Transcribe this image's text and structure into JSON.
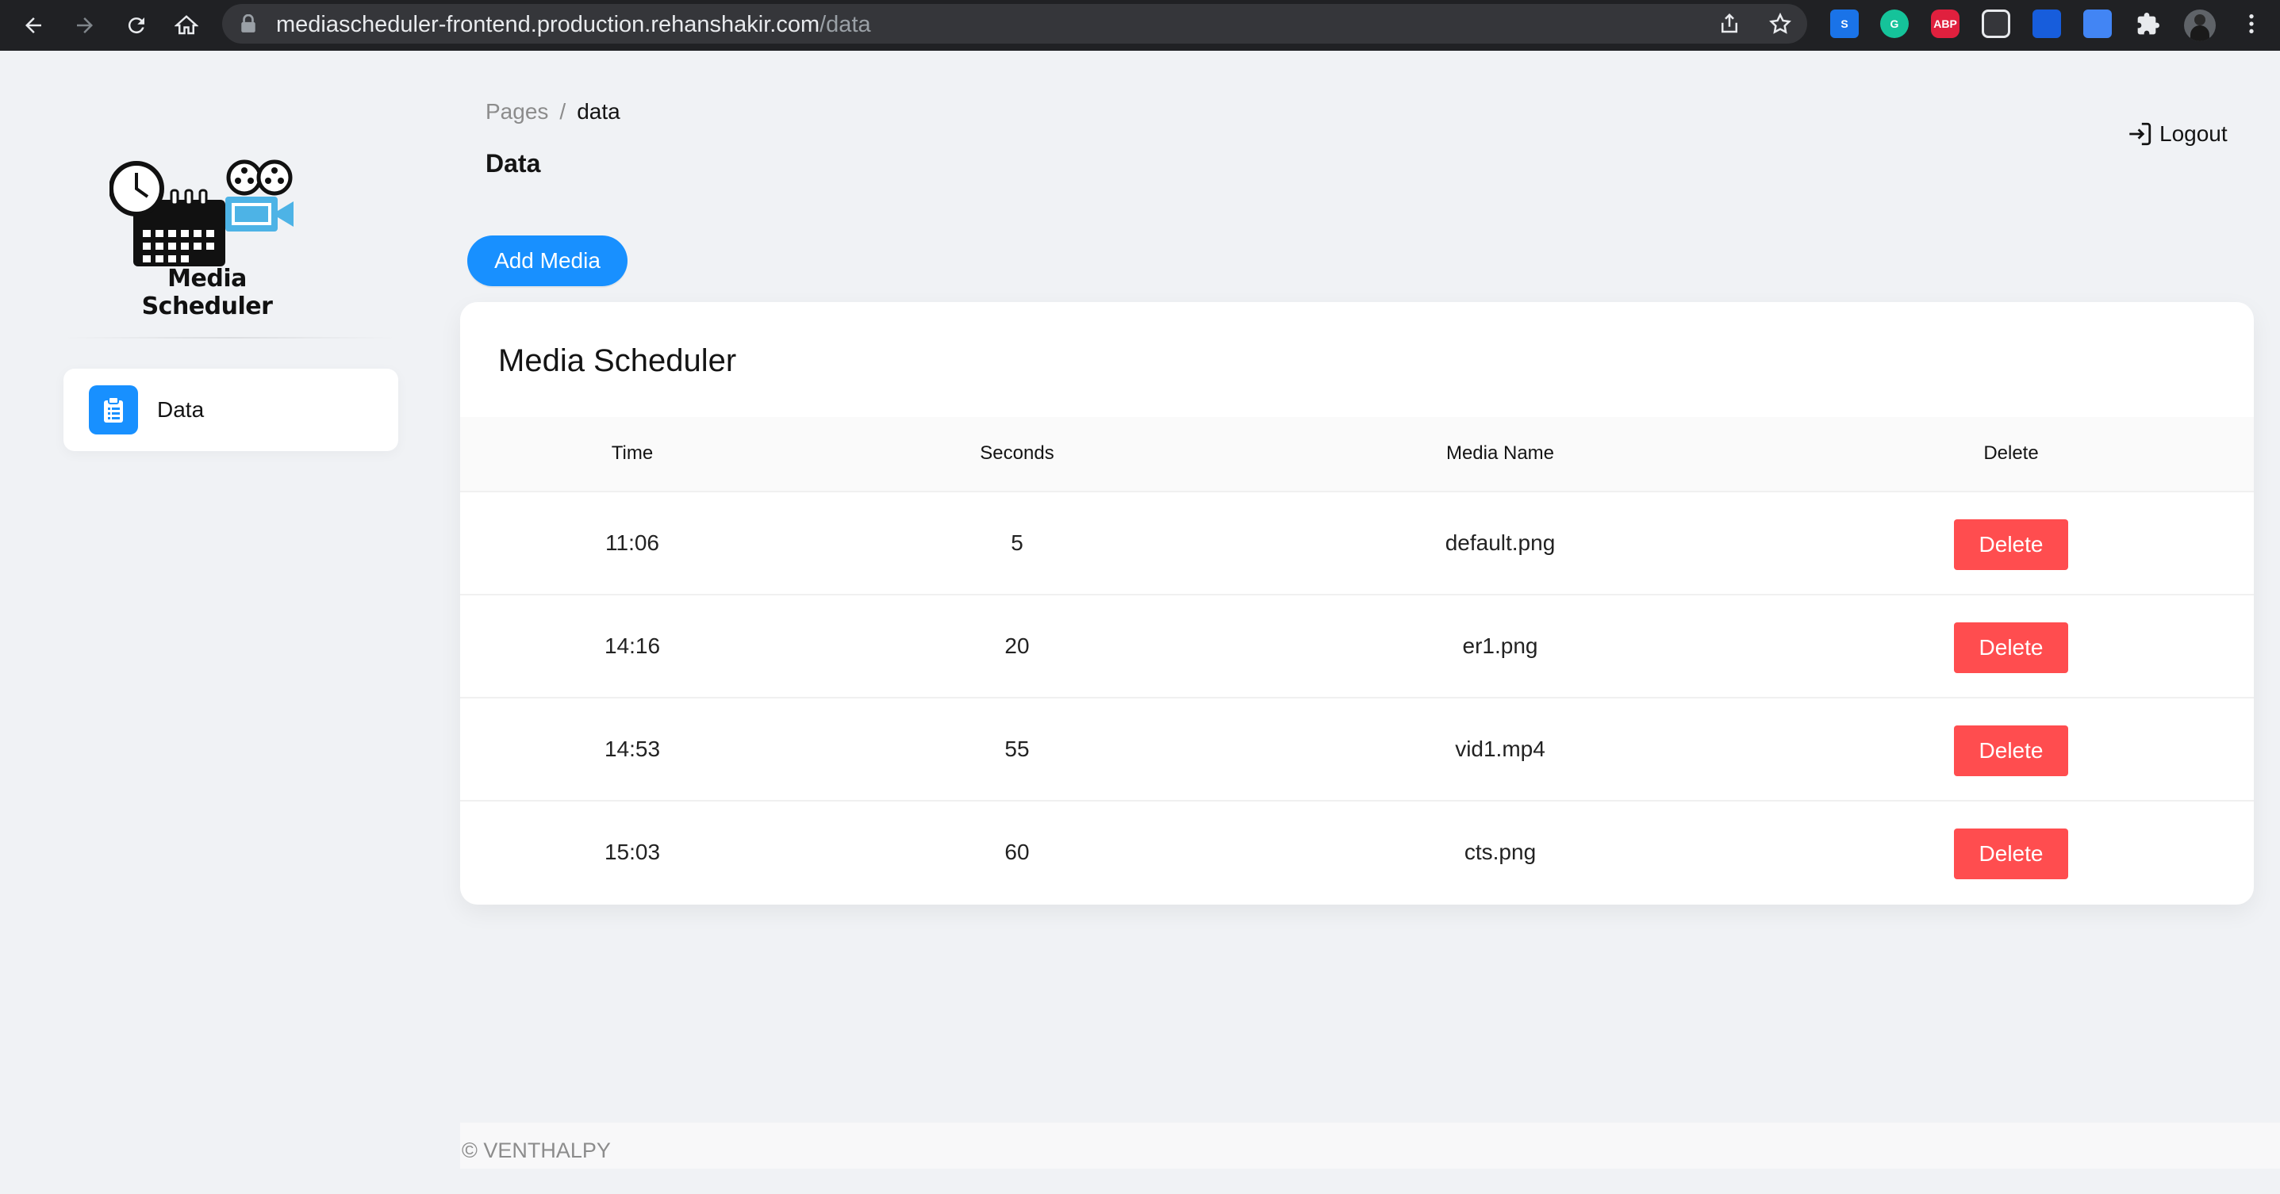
{
  "browser": {
    "url_host": "mediascheduler-frontend.production.rehanshakir.com",
    "url_path": "/data",
    "extensions": [
      {
        "name": "s-extension-icon",
        "label": "S",
        "color": "#1a73e8"
      },
      {
        "name": "grammarly-icon",
        "label": "G",
        "color": "#15c39a"
      },
      {
        "name": "adblock-plus-icon",
        "label": "ABP",
        "color": "#e0203e"
      },
      {
        "name": "pocket-icon",
        "label": "",
        "color": "#35363a"
      },
      {
        "name": "bitwarden-icon",
        "label": "",
        "color": "#175ddc"
      },
      {
        "name": "google-translate-icon",
        "label": "",
        "color": "#4285f4"
      }
    ]
  },
  "sidebar": {
    "logo_text": "Media Scheduler",
    "items": [
      {
        "label": "Data",
        "icon": "clipboard-icon"
      }
    ]
  },
  "header": {
    "breadcrumb_root": "Pages",
    "breadcrumb_sep": "/",
    "breadcrumb_current": "data",
    "title": "Data",
    "logout_label": "Logout"
  },
  "actions": {
    "add_media_label": "Add Media"
  },
  "table": {
    "title": "Media Scheduler",
    "columns": [
      "Time",
      "Seconds",
      "Media Name",
      "Delete"
    ],
    "rows": [
      {
        "time": "11:06",
        "seconds": "5",
        "media": "default.png",
        "delete_label": "Delete"
      },
      {
        "time": "14:16",
        "seconds": "20",
        "media": "er1.png",
        "delete_label": "Delete"
      },
      {
        "time": "14:53",
        "seconds": "55",
        "media": "vid1.mp4",
        "delete_label": "Delete"
      },
      {
        "time": "15:03",
        "seconds": "60",
        "media": "cts.png",
        "delete_label": "Delete"
      }
    ]
  },
  "footer": {
    "text": "© VENTHALPY"
  },
  "colors": {
    "primary": "#1890ff",
    "danger": "#ff4d4f",
    "background": "#f0f2f5"
  }
}
